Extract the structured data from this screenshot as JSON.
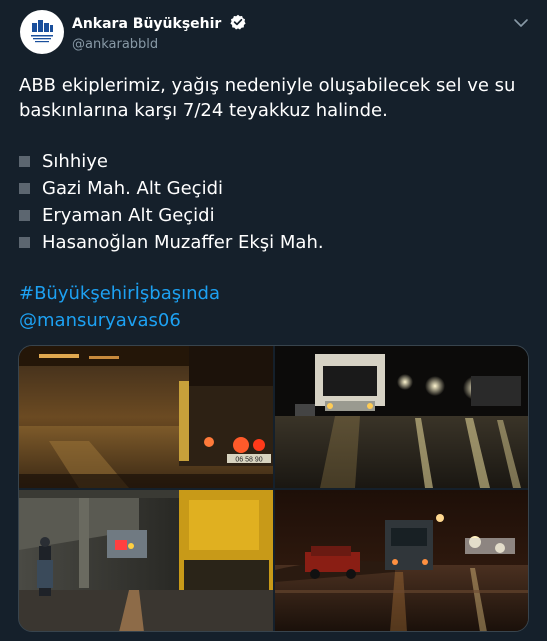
{
  "header": {
    "display_name": "Ankara Büyükşehir",
    "handle": "@ankarabbld",
    "icons": {
      "avatar": "ankara-logo",
      "verified": "verified-badge-icon",
      "more": "chevron-down-icon"
    }
  },
  "tweet": {
    "paragraph": "ABB ekiplerimiz, yağış nedeniyle oluşabilecek sel ve su baskınlarına karşı 7/24 teyakkuz halinde.",
    "list": [
      "Sıhhiye",
      "Gazi Mah. Alt Geçidi",
      "Eryaman Alt Geçidi",
      "Hasanoğlan Muzaffer Ekşi Mah."
    ],
    "hashtag": "#Büyükşehirİşbaşında",
    "mention": "@mansuryavas06"
  },
  "media": {
    "count": 4,
    "photos": [
      {
        "plate_text": "06 58 90"
      },
      {},
      {},
      {}
    ]
  },
  "colors": {
    "background": "#15202b",
    "text": "#ffffff",
    "secondary": "#8899a6",
    "link": "#1da1f2",
    "border": "#38444d"
  }
}
